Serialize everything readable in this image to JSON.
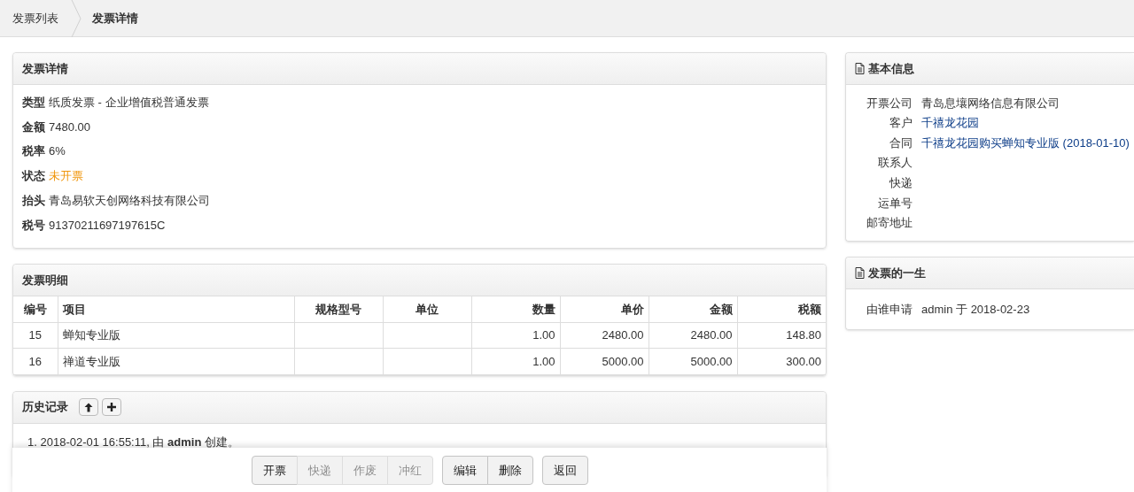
{
  "breadcrumb": [
    {
      "label": "发票列表",
      "current": false
    },
    {
      "label": "发票详情",
      "current": true
    }
  ],
  "details": {
    "title": "发票详情",
    "fields": [
      {
        "label": "类型",
        "value": "纸质发票 - 企业增值税普通发票",
        "kind": "plain"
      },
      {
        "label": "金额",
        "value": "7480.00",
        "kind": "plain"
      },
      {
        "label": "税率",
        "value": "6%",
        "kind": "plain"
      },
      {
        "label": "状态",
        "value": "未开票",
        "kind": "status"
      },
      {
        "label": "抬头",
        "value": "青岛易软天创网络科技有限公司",
        "kind": "plain"
      },
      {
        "label": "税号",
        "value": "91370211697197615C",
        "kind": "plain"
      }
    ]
  },
  "items": {
    "title": "发票明细",
    "columns": [
      "编号",
      "项目",
      "规格型号",
      "单位",
      "数量",
      "单价",
      "金额",
      "税额"
    ],
    "rows": [
      [
        "15",
        "蝉知专业版",
        "",
        "",
        "1.00",
        "2480.00",
        "2480.00",
        "148.80"
      ],
      [
        "16",
        "禅道专业版",
        "",
        "",
        "1.00",
        "5000.00",
        "5000.00",
        "300.00"
      ]
    ]
  },
  "history": {
    "title": "历史记录",
    "entries": [
      {
        "number": "1.",
        "time": "2018-02-01 16:55:11,",
        "by": "由",
        "actor": "admin",
        "action": "创建。"
      }
    ]
  },
  "actions": [
    [
      {
        "label": "开票",
        "disabled": false
      },
      {
        "label": "快递",
        "disabled": true
      },
      {
        "label": "作废",
        "disabled": true
      },
      {
        "label": "冲红",
        "disabled": true
      }
    ],
    [
      {
        "label": "编辑",
        "disabled": false
      },
      {
        "label": "删除",
        "disabled": false
      }
    ],
    [
      {
        "label": "返回",
        "disabled": false
      }
    ]
  ],
  "basic_info": {
    "title": "基本信息",
    "fields": [
      {
        "label": "开票公司",
        "value": "青岛息壤网络信息有限公司",
        "kind": "plain"
      },
      {
        "label": "客户",
        "value": "千禧龙花园",
        "kind": "link"
      },
      {
        "label": "合同",
        "value": "千禧龙花园购买蝉知专业版 (2018-01-10)",
        "kind": "link"
      },
      {
        "label": "联系人"
      },
      {
        "label": "快递"
      },
      {
        "label": "运单号"
      },
      {
        "label": "邮寄地址"
      }
    ]
  },
  "lifecycle": {
    "title": "发票的一生",
    "fields": [
      {
        "label": "由谁申请",
        "value": "admin 于 2018-02-23"
      }
    ]
  }
}
